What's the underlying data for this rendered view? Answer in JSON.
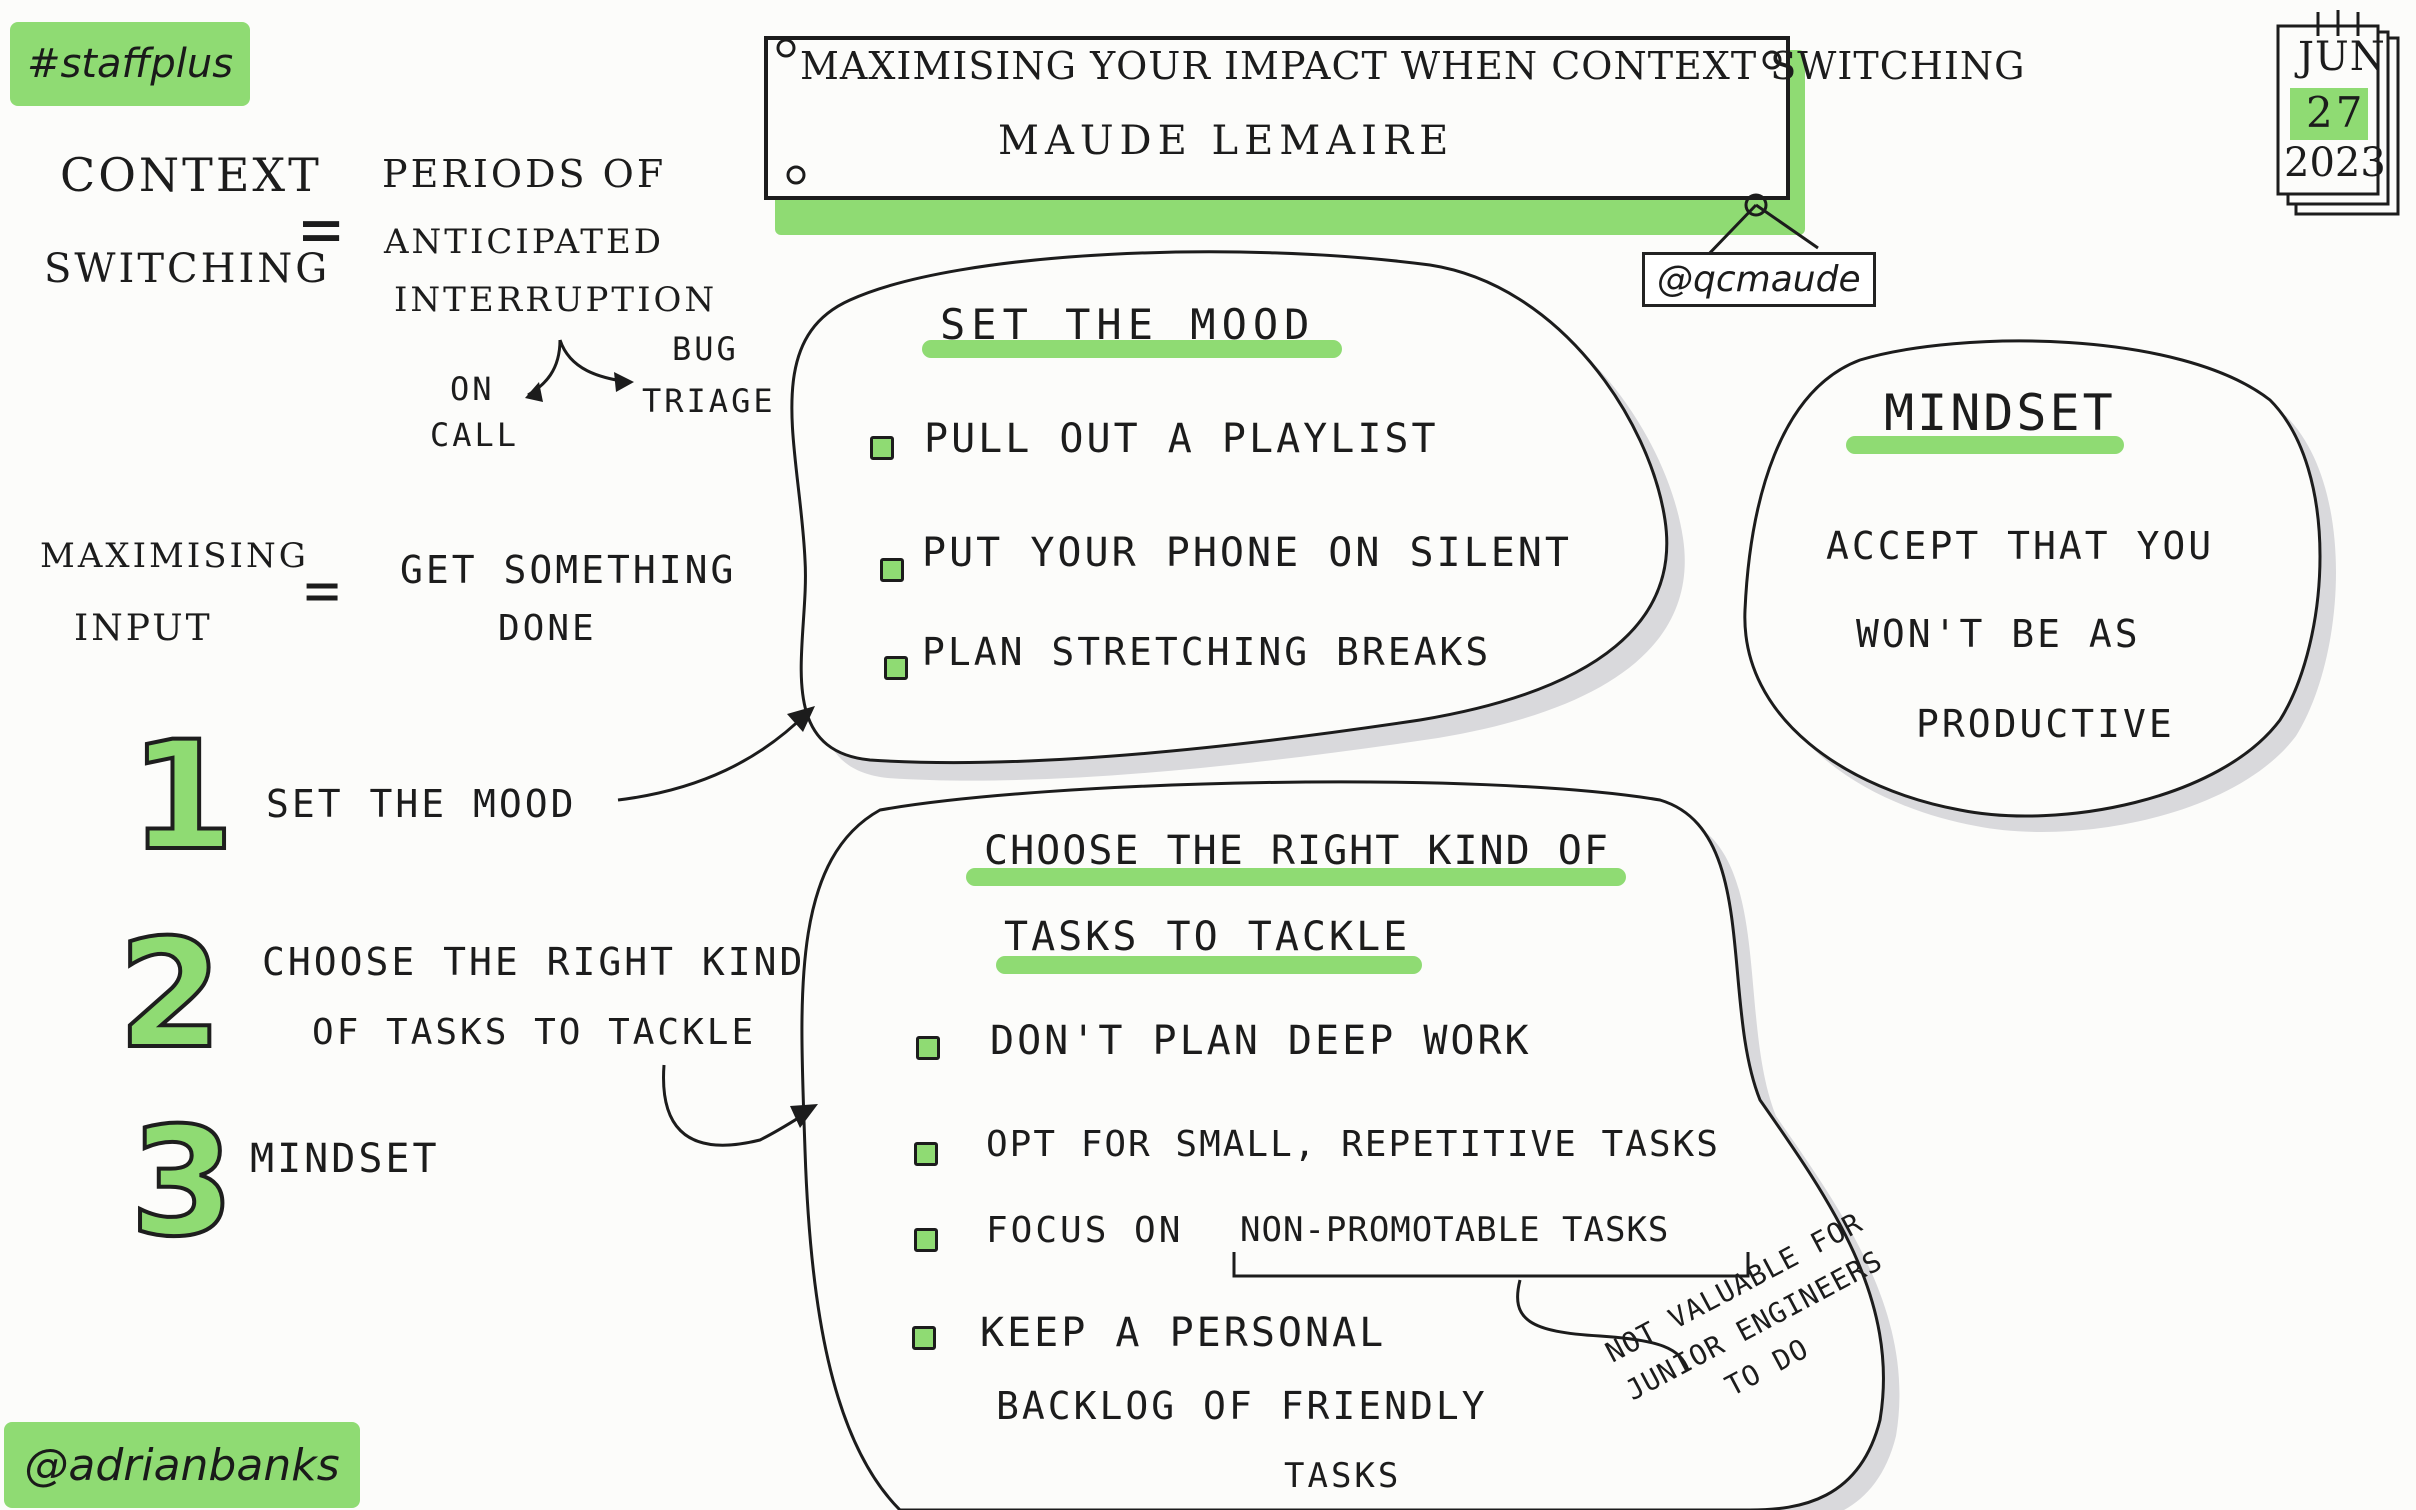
{
  "hashtag": "#staffplus",
  "author_handle": "@adrianbanks",
  "speaker_handle": "@qcmaude",
  "title": {
    "main": "Maximising Your Impact When Context Switching",
    "speaker": "Maude Lemaire"
  },
  "date": {
    "month": "JUN",
    "day": "27",
    "year": "2023"
  },
  "definitions": {
    "context_switching": {
      "term_line1": "Context",
      "term_line2": "Switching",
      "equals": "=",
      "def_line1": "Periods of",
      "def_line2": "Anticipated",
      "def_line3": "Interruption",
      "branch_left_line1": "On",
      "branch_left_line2": "Call",
      "branch_right_line1": "Bug",
      "branch_right_line2": "Triage"
    },
    "maximising_input": {
      "term_line1": "Maximising",
      "term_line2": "Input",
      "equals": "=",
      "def_line1": "Get Something",
      "def_line2": "Done"
    }
  },
  "steps": [
    {
      "number": "1",
      "line1": "Set the mood",
      "line2": ""
    },
    {
      "number": "2",
      "line1": "Choose the right kind",
      "line2": "of tasks to tackle"
    },
    {
      "number": "3",
      "line1": "Mindset",
      "line2": ""
    }
  ],
  "set_the_mood": {
    "heading": "Set the Mood",
    "items": [
      "Pull out a playlist",
      "Put your phone on silent",
      "Plan stretching breaks"
    ]
  },
  "mindset": {
    "heading": "Mindset",
    "line1": "Accept that you",
    "line2": "won't be as",
    "line3": "Productive"
  },
  "choose_tasks": {
    "heading_line1": "Choose the right kind of",
    "heading_line2": "tasks to tackle",
    "items": [
      {
        "prefix": "Don't plan deep work",
        "emph": ""
      },
      {
        "prefix": "Opt for small, repetitive tasks",
        "emph": ""
      },
      {
        "prefix": "Focus on ",
        "emph": "non-promotable tasks"
      },
      {
        "prefix": "Keep a personal",
        "emph": ""
      }
    ],
    "item4_line2": "backlog of friendly",
    "item4_line3": "tasks",
    "annotation_line1": "Not valuable for",
    "annotation_line2": "junior engineers",
    "annotation_line3": "to do"
  },
  "colors": {
    "highlight": "#8fdb73",
    "ink": "#1c1c1c",
    "shadow": "#d8d8dc"
  }
}
